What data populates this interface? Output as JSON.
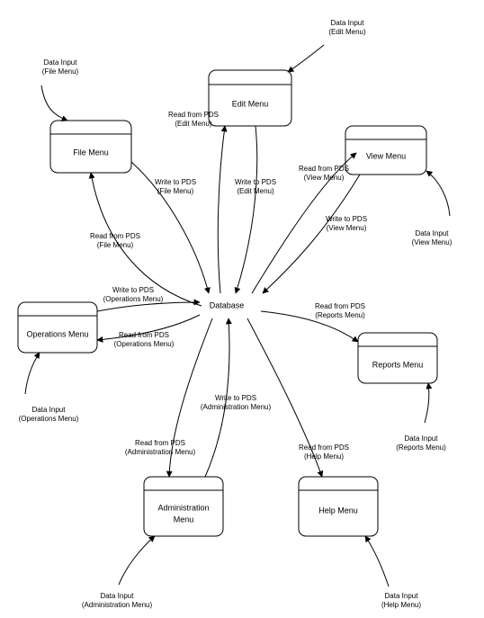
{
  "center": {
    "label": "Database"
  },
  "nodes": {
    "file": {
      "title": "File Menu"
    },
    "edit": {
      "title": "Edit Menu"
    },
    "view": {
      "title": "View Menu"
    },
    "ops": {
      "title": "Operations Menu"
    },
    "reports": {
      "title": "Reports Menu"
    },
    "admin": {
      "title_l1": "Administration",
      "title_l2": "Menu"
    },
    "help": {
      "title": "Help Menu"
    }
  },
  "labels": {
    "file_di_l1": "Data Input",
    "file_di_l2": "(File Menu)",
    "edit_di_l1": "Data Input",
    "edit_di_l2": "(Edit Menu)",
    "view_di_l1": "Data Input",
    "view_di_l2": "(View Menu)",
    "ops_di_l1": "Data Input",
    "ops_di_l2": "(Operations Menu)",
    "reports_di_l1": "Data Input",
    "reports_di_l2": "(Reports  Menu)",
    "admin_di_l1": "Data Input",
    "admin_di_l2": "(Administration Menu)",
    "help_di_l1": "Data Input",
    "help_di_l2": "(Help Menu)",
    "file_read_l1": "Read from PDS",
    "file_read_l2": "(File Menu)",
    "file_write_l1": "Write to PDS",
    "file_write_l2": "(File Menu)",
    "edit_read_l1": "Read from PDS",
    "edit_read_l2": "(Edit Menu)",
    "edit_write_l1": "Write to PDS",
    "edit_write_l2": "(Edit Menu)",
    "view_read_l1": "Read from PDS",
    "view_read_l2": "(View Menu)",
    "view_write_l1": "Write to PDS",
    "view_write_l2": "(View Menu)",
    "ops_write_l1": "Write to PDS",
    "ops_write_l2": "(Operations Menu)",
    "ops_read_l1": "Read from PDS",
    "ops_read_l2": "(Operations Menu)",
    "reports_read_l1": "Read from PDS",
    "reports_read_l2": "(Reports Menu)",
    "admin_write_l1": "Write to PDS",
    "admin_write_l2": "(Administration Menu)",
    "admin_read_l1": "Read from PDS",
    "admin_read_l2": "(Administration Menu)",
    "help_read_l1": "Read from PDS",
    "help_read_l2": "(Help Menu)"
  }
}
